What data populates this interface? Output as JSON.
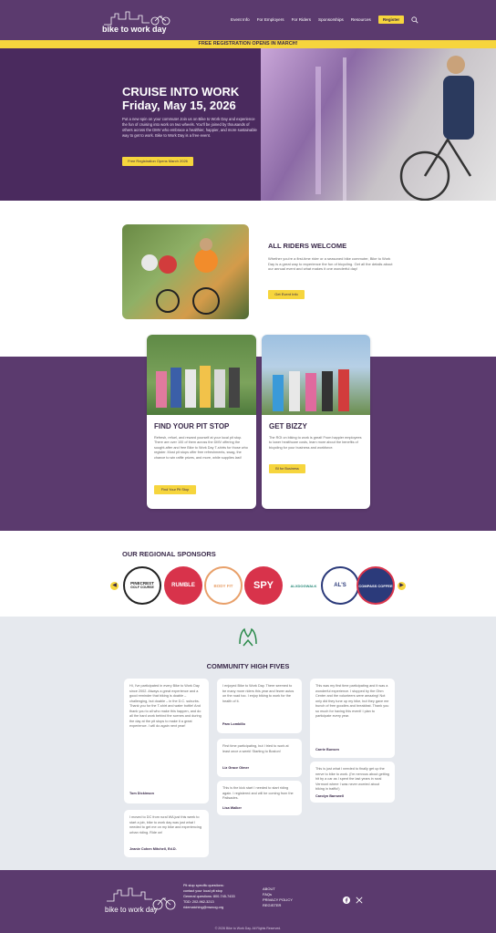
{
  "header": {
    "logo_text": "bike to work day",
    "nav": [
      "Event Info",
      "For Employers",
      "For Riders",
      "Sponsorships",
      "Resources"
    ],
    "register": "Register"
  },
  "banner": "FREE REGISTRATION OPENS IN MARCH!",
  "hero": {
    "title1": "CRUISE INTO WORK",
    "title2": "Friday, May 15, 2026",
    "description": "Put a new spin on your commute! Join us on Bike to Work Day and experience the fun of cruising into work on two wheels. You'll be joined by thousands of others across the DMV who embrace a healthier, happier, and more sustainable way to get to work. Bike to Work Day is a free event.",
    "button": "Free Registration Opens March 2026"
  },
  "riders": {
    "title": "ALL RIDERS WELCOME",
    "description": "Whether you're a first-time rider or a seasoned bike commuter, Bike to Work Day is a great way to experience the fun of bicycling. Get all the details about our annual event and what makes it one wonderful day!",
    "button": "Get Event Info"
  },
  "cards": [
    {
      "title": "FIND YOUR PIT STOP",
      "description": "Refresh, refuel, and reward yourself at your local pit stop. There are over 100 of them across the DMV offering the sought-after and free Bike to Work Day T-shirts for those who register. Most pit stops offer free refreshments, swag, the chance to win raffle prizes, and more, while supplies last!",
      "button": "Find Your Pit Stop"
    },
    {
      "title": "GET BIZZY",
      "description": "The ROI on biking to work is great! From happier employees to lower healthcare costs, learn more about the benefits of bicycling for your business and workforce.",
      "button": "BI for Business"
    }
  ],
  "sponsors": {
    "title": "OUR REGIONAL SPONSORS",
    "items": [
      {
        "name": "PINECREST",
        "sub": "GOLF COURSE"
      },
      {
        "name": "RUMBLE"
      },
      {
        "name": "BODY FIT"
      },
      {
        "name": "SPY"
      },
      {
        "name": "ALXDOGWALK"
      },
      {
        "name": "AL'S"
      },
      {
        "name": "COMPASS COFFEE"
      }
    ]
  },
  "testimonials": {
    "title": "COMMUNITY HIGH FIVES",
    "items": [
      {
        "text": "Hi, I've participated in every Bike to Work Day since 2002. Always a great experience and a good reminder that biking is doable – challenging, but doable – in the D.C. suburbs. Thank you for the T-shirt and water bottle! And thank you to all who make this happen, and do all the hard work behind the scenes and during the day at the pit stops to make it a great experience. I will do again next year!",
        "author": "Tom Dickinson"
      },
      {
        "text": "I moved to DC from rural WA just this week to start a job, bike to work day was just what I needed to get me on my bike and experiencing urban riding. Ride on!",
        "author": "Jeanie Cohen Mitchell, Ed.D."
      },
      {
        "text": "I enjoyed Bike to Work Day. There seemed to be many more riders this year and fewer autos on the road too. I enjoy biking to work for the health of it.",
        "author": "Pam Lombillo"
      },
      {
        "text": "First time participating, but I tried to work at least once a week! Starting to Boston!",
        "author": "Liz Grace Olmer"
      },
      {
        "text": "This is the kick start I needed to start riding again. I registered and will be coming from the Palisades.",
        "author": "Lisa Walker"
      },
      {
        "text": "This was my first time participating and it was a wonderful experience. I stopped by the Ohm Center and the volunteers were amazing! Not only did they tune up my bike, but they gave me bunch of free goodies and breakfast. Thank you so much for having this event! I plan to participate every year.",
        "author": "Carrie Bunsen"
      },
      {
        "text": "This is just what I needed to finally get up the nerve to bike to work. (I'm nervous about getting hit by a car as I spent the last years in rural Vermont where I was never worried about biking in traffic!)",
        "author": "Carolyn Barnwell"
      }
    ]
  },
  "footer": {
    "contact": [
      "Pit stop specific questions:",
      "contact your local pit stop",
      "General questions: 800-745-7433",
      "TDD: 202-962-3213",
      "ridematching@mwcog.org"
    ],
    "links": [
      "ABOUT",
      "FAQs",
      "PRIVACY POLICY",
      "REGISTER"
    ],
    "copyright": "© 2026 Bike to Work Day. All Rights Reserved."
  }
}
